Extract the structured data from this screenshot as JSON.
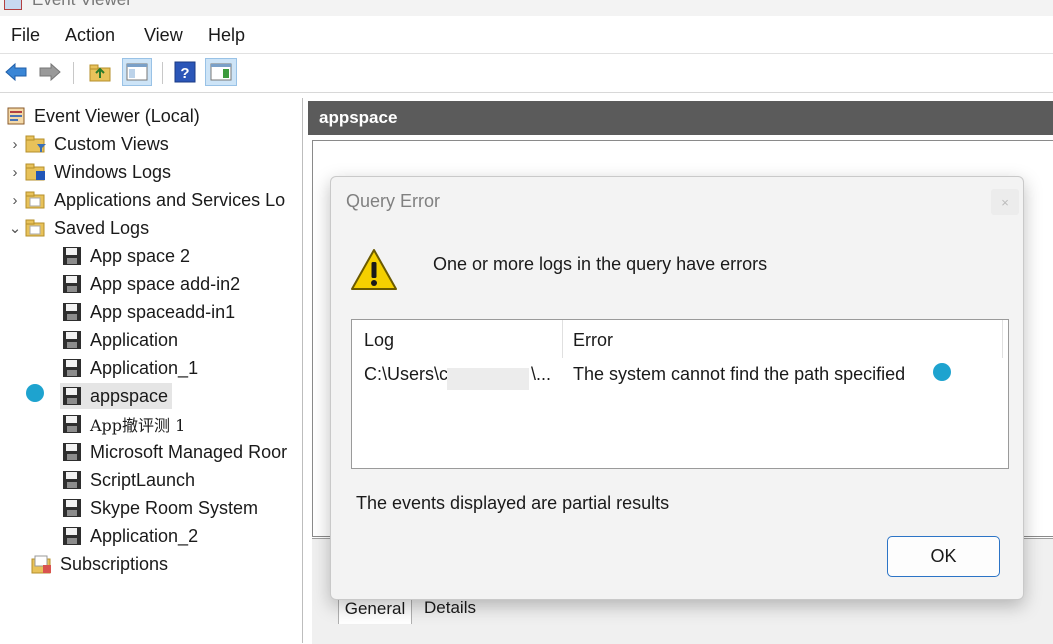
{
  "window": {
    "title": "Event Viewer"
  },
  "menu": [
    "File",
    "Action",
    "View",
    "Help"
  ],
  "toolbar": {
    "icons": [
      "back-arrow-icon",
      "forward-arrow-icon",
      "up-folder-icon",
      "show-hide-tree-icon",
      "help-icon",
      "show-hide-action-pane-icon"
    ]
  },
  "tree": {
    "root": "Event Viewer (Local)",
    "nodes": [
      "Custom Views",
      "Windows Logs",
      "Applications and Services Lo",
      "Saved Logs"
    ],
    "saved_logs": [
      "App space 2",
      "App space add-in2",
      "App spaceadd-in1",
      "Application",
      "Application_1",
      "appspace",
      "App撤评测 1",
      "Microsoft Managed Roor",
      "ScriptLaunch",
      "Skype Room System",
      "Application_2"
    ],
    "subscriptions": "Subscriptions",
    "selected": "appspace"
  },
  "pane": {
    "title": "appspace",
    "tabs": [
      "General",
      "Details"
    ]
  },
  "dialog": {
    "title": "Query Error",
    "close_glyph": "×",
    "message": "One or more logs in the query have errors",
    "table": {
      "columns": [
        "Log",
        "Error"
      ],
      "rows": [
        {
          "log_prefix": "C:\\Users\\c",
          "log_suffix": "\\...",
          "error": "The system cannot find the path specified"
        }
      ]
    },
    "partial_note": "The events displayed are partial results",
    "ok_label": "OK"
  },
  "colors": {
    "marker": "#1ea3cf",
    "header_bar": "#5b5b5b",
    "ok_border": "#2c74c6"
  }
}
